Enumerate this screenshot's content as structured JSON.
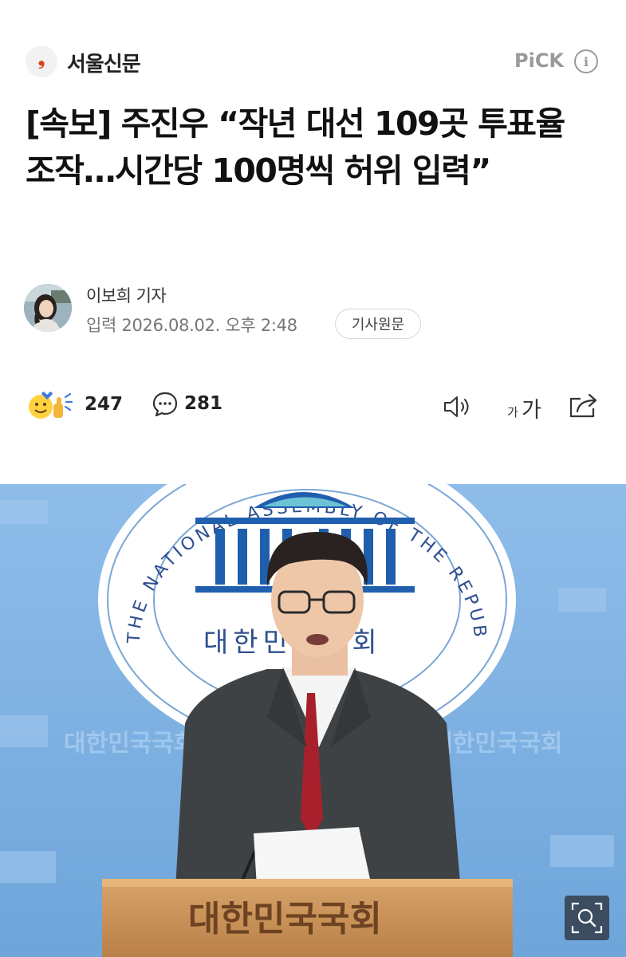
{
  "press": {
    "name": "서울신문",
    "logo_glyph": "❟",
    "accent_color": "#d9401f",
    "pick_label": "PiCK",
    "info_icon": "info-icon"
  },
  "article": {
    "headline": "[속보] 주진우 “작년 대선 109곳 투표율 조작…시간당 100명씩 허위 입력”",
    "reporter": "이보희 기자",
    "published": "입력 2026.08.02. 오후 2:48",
    "origin_button": "기사원문"
  },
  "actions": {
    "reaction_count": "247",
    "comment_count": "281",
    "icons": [
      "reaction-emoji-icon",
      "comment-icon",
      "speaker-icon",
      "font-size-icon",
      "share-icon"
    ],
    "fontsize_small": "가",
    "fontsize_large": "가"
  },
  "photo": {
    "emblem_ring_text": "THE NATIONAL ASSEMBLY OF THE REPUBLIC OF KOREA",
    "emblem_korean": "대한민국국회",
    "podium_text": "대한민국국회",
    "wall_text": "대한민국국회",
    "zoom_icon": "zoom-icon"
  }
}
